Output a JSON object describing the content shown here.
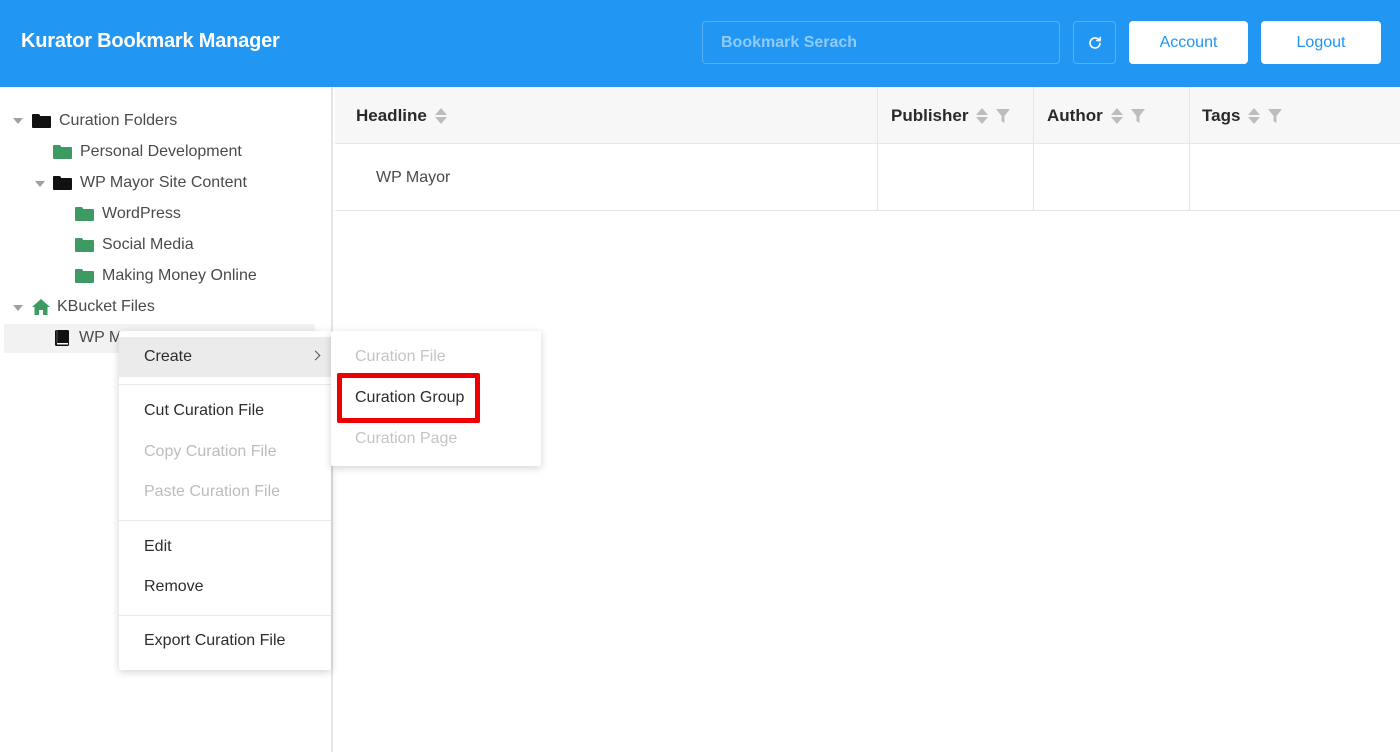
{
  "header": {
    "title": "Kurator Bookmark Manager",
    "search_placeholder": "Bookmark Serach",
    "account_label": "Account",
    "logout_label": "Logout",
    "accent_color": "#2196f3"
  },
  "sidebar": {
    "curation_folders": "Curation Folders",
    "personal_development": "Personal Development",
    "wp_mayor_site_content": "WP Mayor Site Content",
    "wordpress": "WordPress",
    "social_media": "Social Media",
    "making_money_online": "Making Money Online",
    "kbucket_files": "KBucket Files",
    "wp_mayor_truncated": "WP M"
  },
  "table": {
    "columns": [
      "Headline",
      "Publisher",
      "Author",
      "Tags"
    ],
    "rows": [
      {
        "headline": "WP Mayor",
        "publisher": "",
        "author": "",
        "tags": ""
      }
    ]
  },
  "context_menu": {
    "create": "Create",
    "cut": "Cut Curation File",
    "copy": "Copy Curation File",
    "paste": "Paste Curation File",
    "edit": "Edit",
    "remove": "Remove",
    "export": "Export Curation File"
  },
  "submenu": {
    "curation_file": "Curation File",
    "curation_group": "Curation Group",
    "curation_page": "Curation Page"
  }
}
